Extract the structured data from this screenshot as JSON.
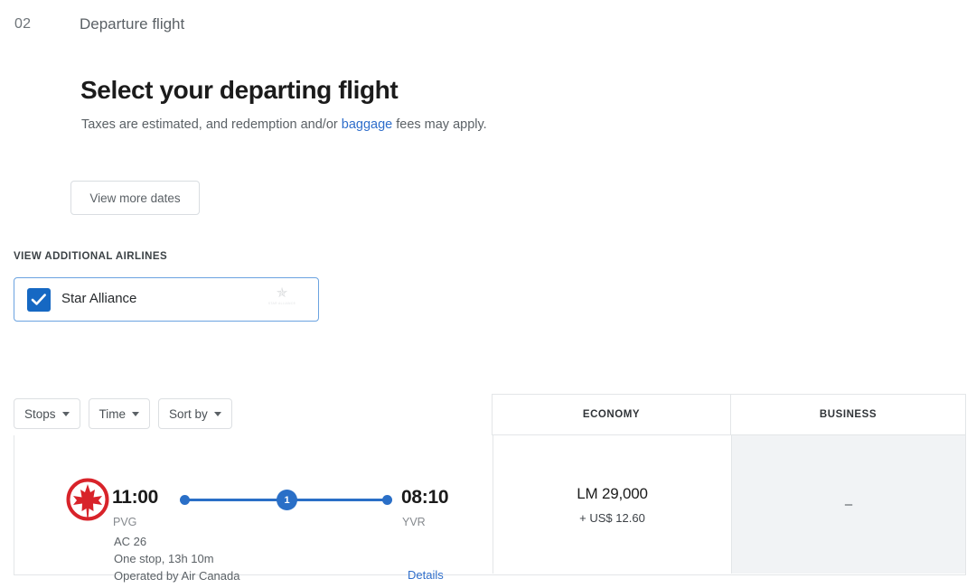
{
  "step": {
    "number": "02",
    "label": "Departure flight"
  },
  "heading": {
    "title": "Select your departing flight",
    "subtitle_before": "Taxes are estimated, and redemption and/or ",
    "subtitle_link": "baggage",
    "subtitle_after": " fees may apply."
  },
  "actions": {
    "view_more_dates": "View more dates"
  },
  "airlines_filter": {
    "section_label": "VIEW ADDITIONAL AIRLINES",
    "option_label": "Star Alliance",
    "checked": true,
    "logo_name": "star-alliance-logo",
    "logo_wordmark": "STAR ALLIANCE"
  },
  "filters": [
    {
      "label": "Stops",
      "name": "stops"
    },
    {
      "label": "Time",
      "name": "time"
    },
    {
      "label": "Sort by",
      "name": "sort-by"
    }
  ],
  "table": {
    "columns": [
      {
        "label": "ECONOMY",
        "name": "economy"
      },
      {
        "label": "BUSINESS",
        "name": "business"
      }
    ],
    "rows": [
      {
        "airline_logo": "air-canada-logo",
        "departure_time": "11:00",
        "departure_code": "PVG",
        "arrival_time": "08:10",
        "arrival_code": "YVR",
        "stops_count": "1",
        "flight_number": "AC 26",
        "duration": "One stop, 13h 10m",
        "operated_by": "Operated by Air Canada",
        "details_label": "Details",
        "economy": {
          "points": "LM 29,000",
          "taxes": "+ US$ 12.60",
          "available": true
        },
        "business": {
          "placeholder": "–",
          "available": false
        }
      }
    ]
  },
  "colors": {
    "accent_blue": "#2a6fc7",
    "link_blue": "#2f6ecb",
    "checkbox_blue": "#1668c3",
    "air_canada_red": "#d8232a",
    "unavailable_bg": "#f1f3f5",
    "border": "#e3e6e8"
  }
}
